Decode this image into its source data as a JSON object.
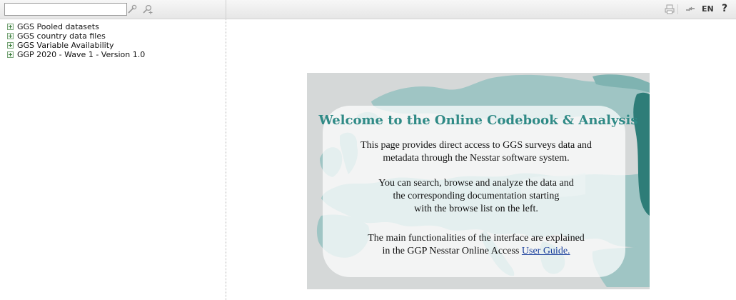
{
  "toolbar": {
    "search": {
      "value": "",
      "placeholder": ""
    },
    "icons": [
      "search-key-icon",
      "advanced-search-icon",
      "print-icon",
      "link-icon"
    ],
    "language": "EN",
    "help": "?"
  },
  "sidebar": {
    "items": [
      {
        "label": "GGS Pooled datasets"
      },
      {
        "label": "GGS country data files"
      },
      {
        "label": "GGS Variable Availability"
      },
      {
        "label": "GGP 2020 - Wave 1 - Version 1.0"
      }
    ]
  },
  "welcome": {
    "title": "Welcome to the Online Codebook & Analysis",
    "p1_line1": "This page provides direct access to GGS surveys data and",
    "p1_line2": "metadata through the Nesstar software system.",
    "p2_line1": "You can search, browse and analyze the data and",
    "p2_line2": "the corresponding documentation starting",
    "p2_line3": "with the browse list on the left.",
    "p3_line1": "The main functionalities of the interface are explained",
    "p3_line2_prefix": "in the GGP Nesstar Online Access",
    "p3_link": "User Guide.",
    "colors": {
      "title": "#2f8a86",
      "land": "#9fc5c4",
      "sea": "#d5d8d8",
      "dark_land": "#2e7d78",
      "link": "#1a3f9c"
    }
  }
}
